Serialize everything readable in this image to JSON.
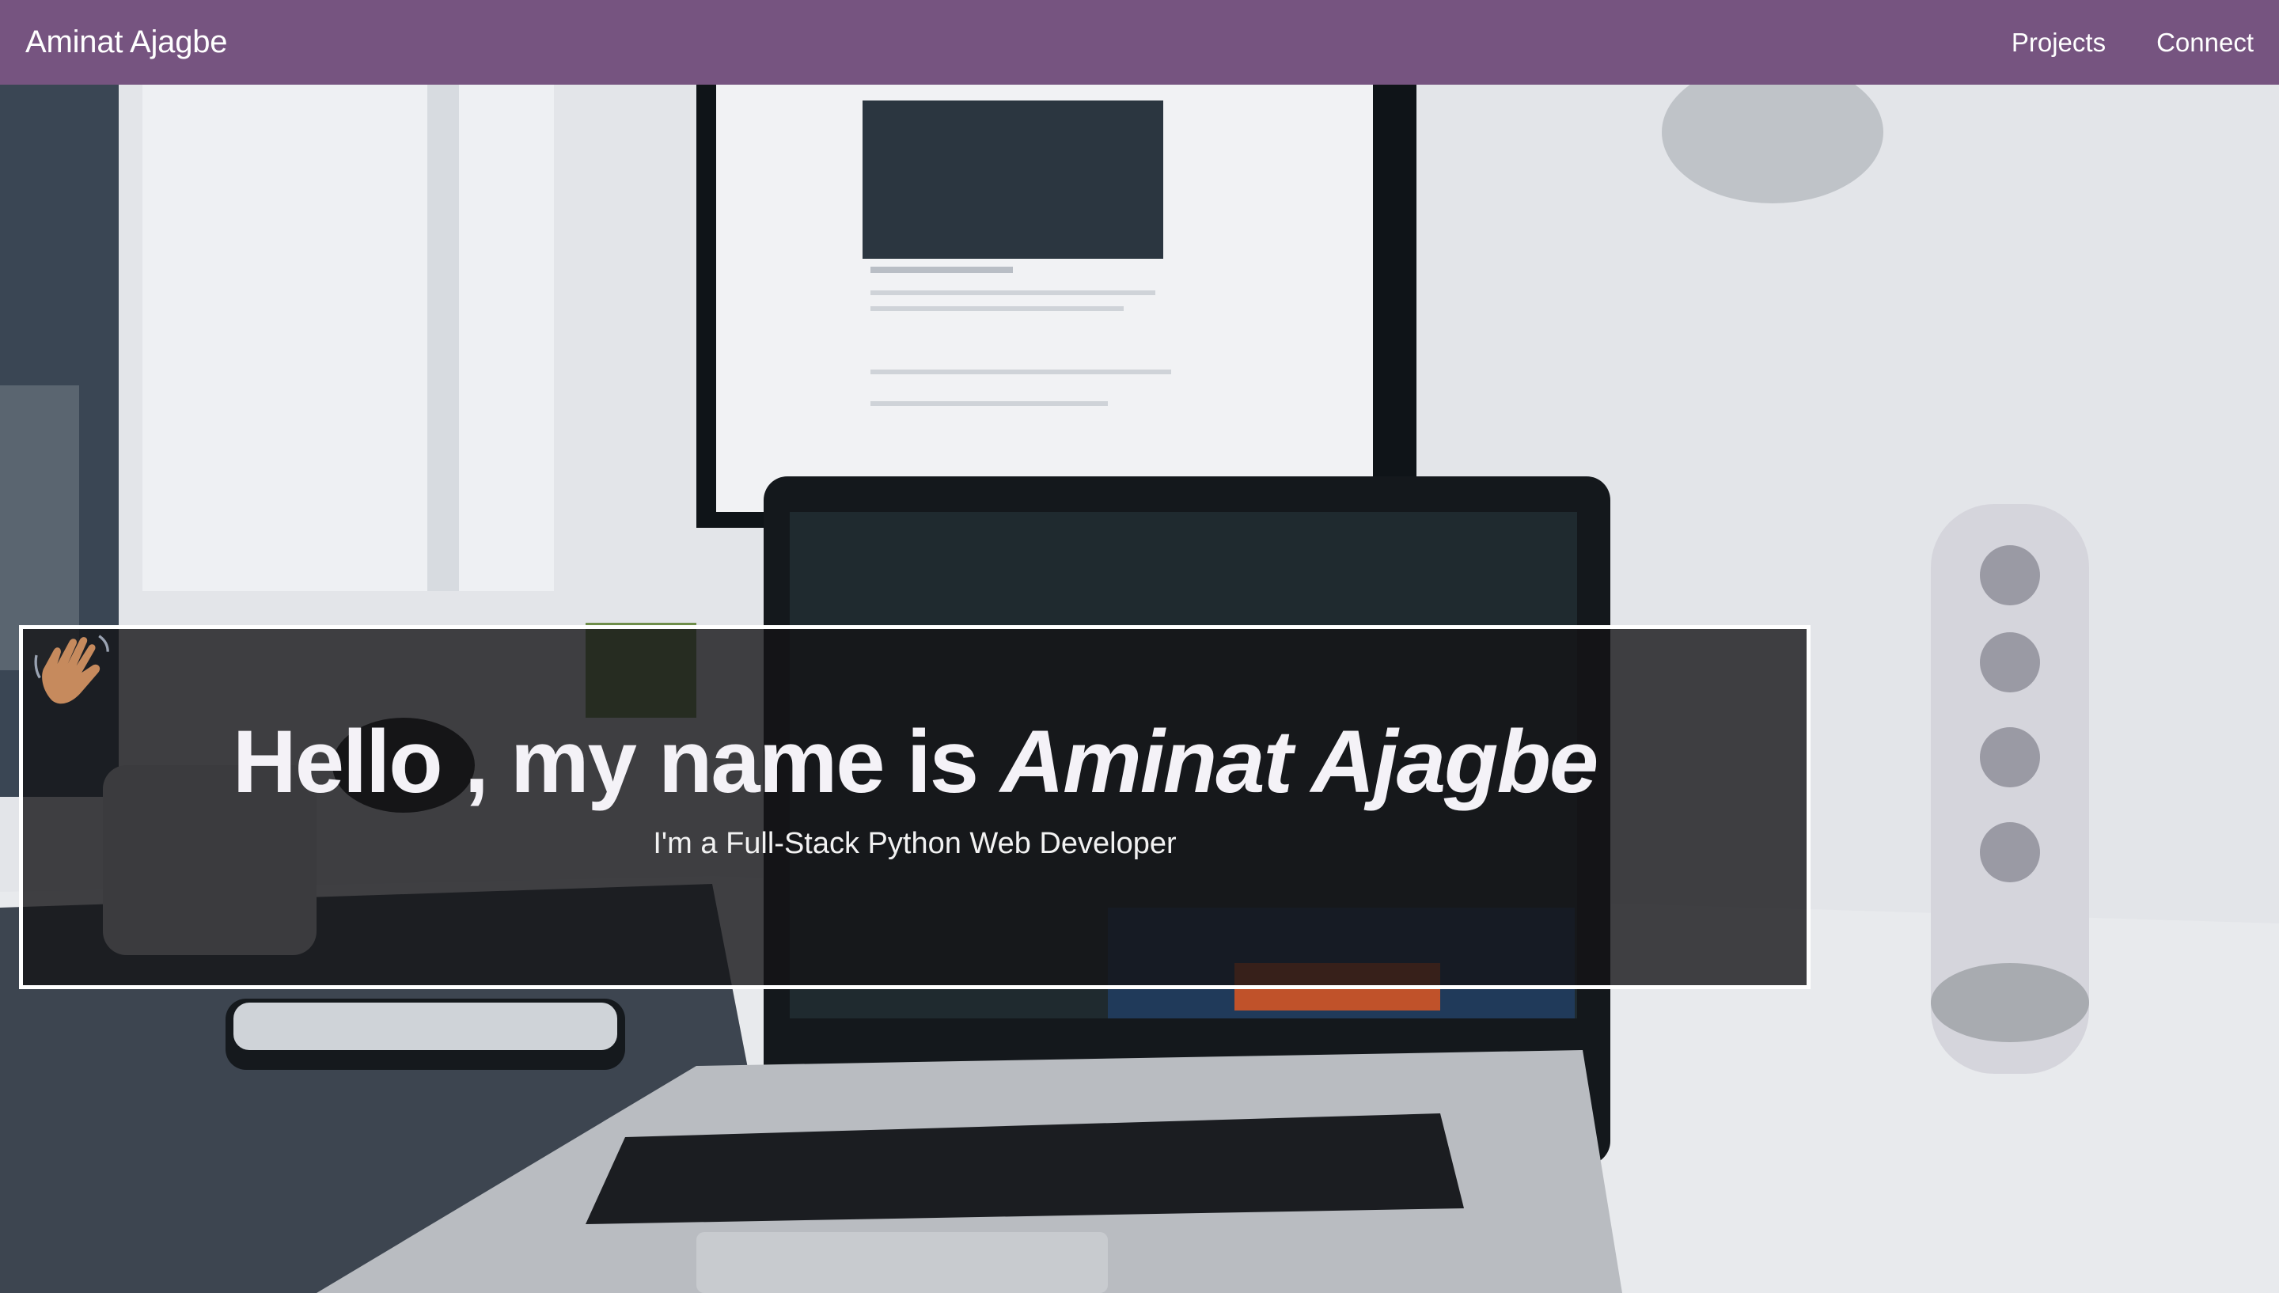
{
  "nav": {
    "brand": "Aminat Ajagbe",
    "links": [
      {
        "label": "Projects"
      },
      {
        "label": "Connect"
      }
    ],
    "background": "#765480"
  },
  "hero": {
    "background_description_icon": "laptop-desk-photo",
    "intro": {
      "greeting": "Hello",
      "wave_icon": "waving-hand-icon",
      "middle": ", my name is",
      "name": "Aminat Ajagbe",
      "tagline": "I'm a Full-Stack Python Web Developer"
    }
  }
}
